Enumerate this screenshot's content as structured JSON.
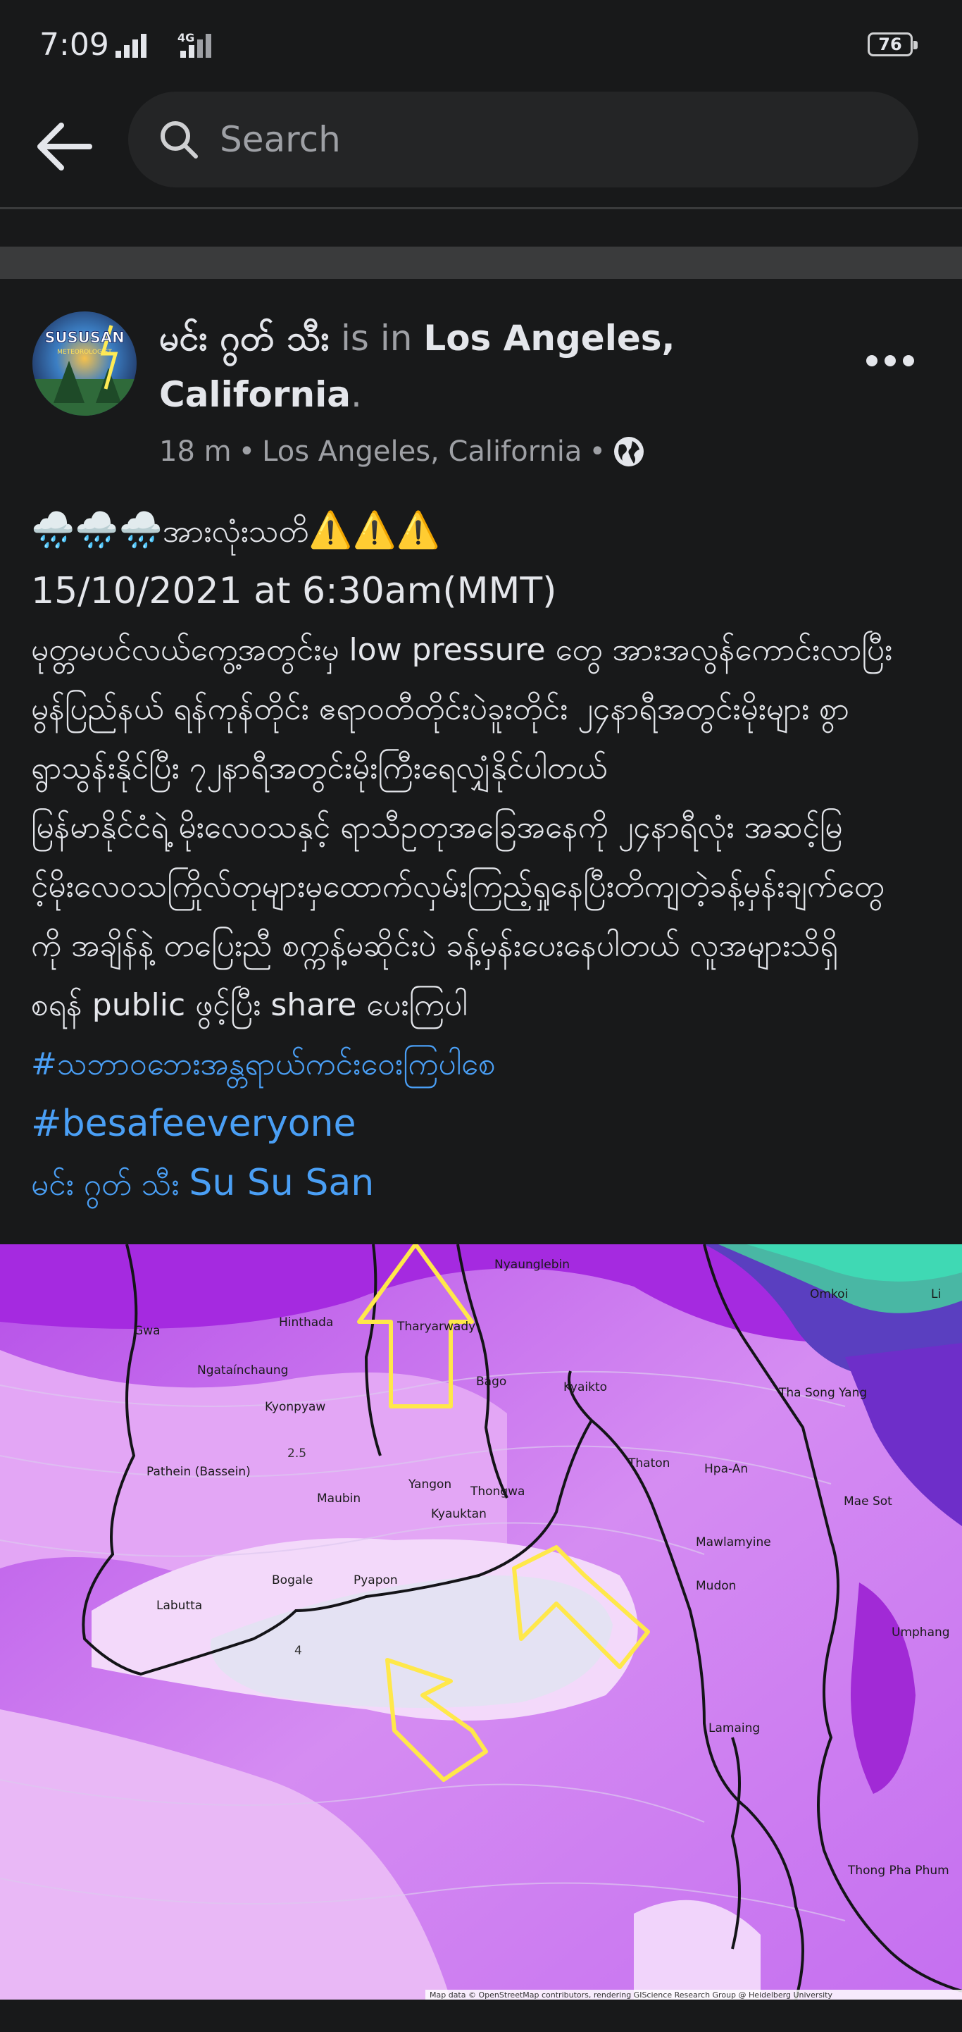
{
  "status_bar": {
    "time": "7:09",
    "network": "4G",
    "battery": "76"
  },
  "nav": {
    "search_placeholder": "Search",
    "back_icon": "arrow-left-icon",
    "search_icon": "search-icon"
  },
  "post": {
    "author": "မင်း ဂွတ် သီး",
    "checkin_text": "is in",
    "location_bold": "Los Angeles,",
    "location_bold_2": "California",
    "period": ".",
    "time": "18 m",
    "meta_location": "Los Angeles, California",
    "bullet": "•",
    "privacy_icon": "globe-icon",
    "more_icon": "more-horizontal-icon",
    "avatar_text": "SUSUSAN",
    "avatar_subtext": "METEOROLOGIST",
    "headline_emojis_left": "🌧️🌧️🌧️",
    "headline_text": "အားလုံးသတိ",
    "headline_emojis_right": "⚠️⚠️⚠️",
    "date_line": "15/10/2021 at 6:30am(MMT)",
    "body_lines": [
      "မုတ္တမပင်လယ်ကွေ့အတွင်းမှ low pressure တွေ အားအလွန်ကောင်းလာပြီး",
      "မွန်ပြည်နယ် ရန်ကုန်တိုင်း ဧရာဝတီတိုင်းပဲခူးတိုင်း ၂၄နာရီအတွင်းမိုးများ စွာ",
      "ရွာသွန်းနိုင်ပြီး ၇၂နာရီအတွင်းမိုးကြီးရေလျှံနိုင်ပါတယ်",
      " မြန်မာနိုင်ငံရဲ့ မိုးလေဝသနှင့် ရာသီဥတုအခြေအနေကို ၂၄နာရီလုံး အဆင့်မြ",
      "င့်မိုးလေဝသကြိုလ်တုများမှထောက်လှမ်းကြည့်ရှုနေပြီးတိကျတဲ့ခန့်မှန်းချက်တွေ",
      "ကို အချိန်နဲ့ တပြေးညီ စက္ကန့်မဆိုင်းပဲ ခန့်မှန်းပေးနေပါတယ် လူအများသိရှိ",
      "စရန် public ဖွင့်ပြီး share ပေးကြပါ"
    ],
    "hashtag_1": "#သဘာဝဘေးအန္တရာယ်ကင်းဝေးကြပါစေ",
    "hashtag_2": "#besafeeveryone",
    "tag_author": "မင်း ဂွတ် သီး",
    "tag_user": "Su Su San"
  },
  "map": {
    "places": [
      "Nyaunglebin",
      "Hinthada",
      "Tharyarwady",
      "Omkoi",
      "Li",
      "Gwa",
      "Ngataínchaung",
      "Kyonpyaw",
      "Bago",
      "Kyaikto",
      "Tha Song Yang",
      "Pathein (Bassein)",
      "Maubin",
      "Yangon",
      "Thongwa",
      "Thaton",
      "Hpa-An",
      "Mae Sot",
      "Kyauktan",
      "Mawlamyine",
      "Bogale",
      "Pyapon",
      "Mudon",
      "Labutta",
      "Umphang",
      "Lamaing",
      "Thong Pha Phum"
    ],
    "contour_labels": [
      "2.5",
      "4"
    ],
    "attribution": "Map data © OpenStreetMap contributors, rendering GIScience Research Group @ Heidelberg University"
  },
  "colors": {
    "background": "#18191a",
    "link": "#4a9ff5",
    "muted": "#9ea0a5",
    "text": "#e4e6eb",
    "arrow": "#ffe84a"
  }
}
